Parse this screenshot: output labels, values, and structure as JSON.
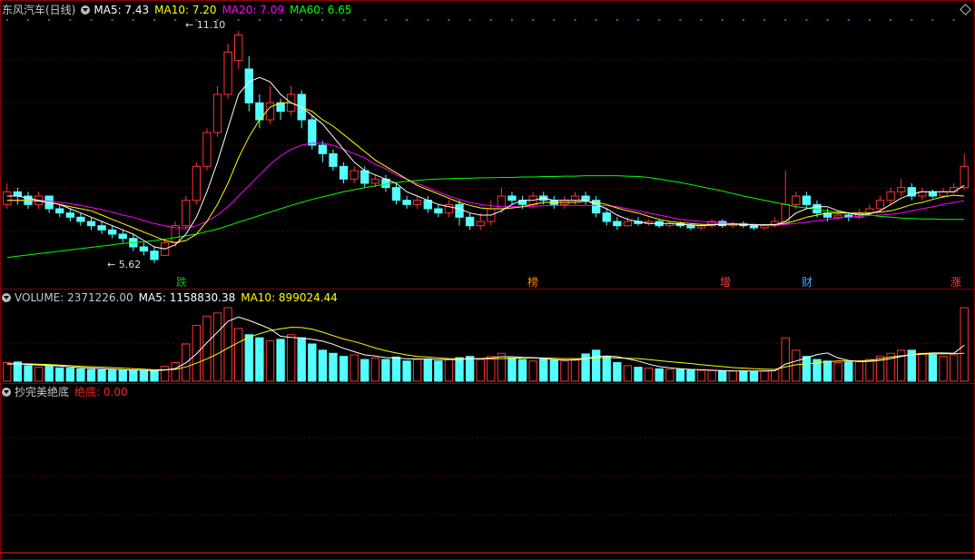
{
  "main": {
    "title": "东风汽车(日线)",
    "ma5_label": "MA5: 7.43",
    "ma10_label": "MA10: 7.20",
    "ma20_label": "MA20: 7.09",
    "ma60_label": "MA60: 6.65",
    "high_label": "11.10",
    "low_label": "5.62",
    "colors": {
      "ma5": "#ffffff",
      "ma10": "#ffff00",
      "ma20": "#ff00ff",
      "ma60": "#00ff00",
      "up": "#ff3232",
      "down": "#54ffff"
    }
  },
  "events": [
    {
      "label": "跌",
      "color": "#00c000"
    },
    {
      "label": "榜",
      "color": "#ff8c00"
    },
    {
      "label": "增",
      "color": "#ff4040"
    },
    {
      "label": "财",
      "color": "#4da6ff"
    },
    {
      "label": "涨",
      "color": "#ff4040"
    }
  ],
  "volume": {
    "title": "VOLUME: 2371226.00",
    "ma5_label": "MA5: 1158830.38",
    "ma10_label": "MA10: 899024.44"
  },
  "indicator": {
    "title": "抄完美绝底",
    "value_label": "绝底: 0.00"
  },
  "chart_data": {
    "type": "candlestick",
    "price_range": [
      5.4,
      11.4
    ],
    "candles": [
      [
        7.0,
        7.3,
        7.5,
        6.9
      ],
      [
        7.3,
        7.2,
        7.4,
        7.0
      ],
      [
        7.2,
        7.0,
        7.3,
        6.9
      ],
      [
        7.0,
        7.2,
        7.3,
        6.9
      ],
      [
        7.2,
        6.9,
        7.2,
        6.8
      ],
      [
        6.9,
        6.8,
        7.0,
        6.7
      ],
      [
        6.8,
        6.7,
        6.9,
        6.6
      ],
      [
        6.7,
        6.6,
        6.8,
        6.5
      ],
      [
        6.6,
        6.5,
        6.7,
        6.4
      ],
      [
        6.5,
        6.4,
        6.6,
        6.3
      ],
      [
        6.4,
        6.3,
        6.5,
        6.2
      ],
      [
        6.3,
        6.2,
        6.4,
        6.1
      ],
      [
        6.2,
        6.0,
        6.3,
        5.9
      ],
      [
        6.0,
        5.9,
        6.1,
        5.8
      ],
      [
        5.9,
        5.7,
        6.0,
        5.62
      ],
      [
        5.8,
        6.1,
        6.2,
        5.8
      ],
      [
        6.1,
        6.5,
        6.6,
        6.0
      ],
      [
        6.5,
        7.1,
        7.2,
        6.4
      ],
      [
        7.1,
        7.9,
        8.0,
        7.0
      ],
      [
        7.9,
        8.7,
        8.8,
        7.8
      ],
      [
        8.7,
        9.6,
        9.8,
        8.6
      ],
      [
        9.6,
        10.6,
        10.8,
        9.5
      ],
      [
        10.4,
        11.0,
        11.1,
        10.2
      ],
      [
        10.2,
        9.4,
        10.5,
        9.2
      ],
      [
        9.4,
        9.0,
        9.6,
        8.8
      ],
      [
        9.0,
        9.4,
        9.8,
        8.9
      ],
      [
        9.4,
        9.2,
        9.5,
        9.0
      ],
      [
        9.2,
        9.6,
        9.8,
        9.1
      ],
      [
        9.6,
        9.0,
        9.7,
        8.8
      ],
      [
        9.0,
        8.4,
        9.1,
        8.3
      ],
      [
        8.4,
        8.2,
        8.5,
        8.0
      ],
      [
        8.2,
        7.9,
        8.3,
        7.8
      ],
      [
        7.9,
        7.6,
        8.0,
        7.5
      ],
      [
        7.6,
        7.8,
        7.9,
        7.5
      ],
      [
        7.8,
        7.5,
        7.9,
        7.4
      ],
      [
        7.5,
        7.6,
        7.7,
        7.4
      ],
      [
        7.6,
        7.4,
        7.7,
        7.3
      ],
      [
        7.4,
        7.1,
        7.5,
        7.0
      ],
      [
        7.1,
        7.0,
        7.2,
        6.9
      ],
      [
        7.0,
        7.1,
        7.2,
        6.9
      ],
      [
        7.1,
        6.9,
        7.2,
        6.8
      ],
      [
        6.9,
        6.8,
        7.0,
        6.7
      ],
      [
        6.8,
        7.0,
        7.1,
        6.7
      ],
      [
        7.0,
        6.7,
        7.1,
        6.5
      ],
      [
        6.7,
        6.5,
        6.8,
        6.4
      ],
      [
        6.5,
        6.6,
        6.8,
        6.4
      ],
      [
        6.6,
        6.9,
        7.1,
        6.5
      ],
      [
        6.9,
        7.2,
        7.4,
        6.8
      ],
      [
        7.2,
        7.1,
        7.3,
        7.0
      ],
      [
        7.1,
        7.0,
        7.2,
        6.9
      ],
      [
        7.0,
        7.2,
        7.3,
        6.9
      ],
      [
        7.2,
        7.1,
        7.3,
        7.0
      ],
      [
        7.1,
        7.0,
        7.2,
        6.9
      ],
      [
        7.0,
        7.1,
        7.2,
        6.9
      ],
      [
        7.1,
        7.2,
        7.3,
        7.0
      ],
      [
        7.2,
        7.1,
        7.3,
        7.0
      ],
      [
        7.1,
        6.8,
        7.2,
        6.7
      ],
      [
        6.8,
        6.6,
        6.9,
        6.5
      ],
      [
        6.6,
        6.5,
        6.7,
        6.4
      ],
      [
        6.5,
        6.6,
        6.7,
        6.5
      ],
      [
        6.6,
        6.55,
        6.7,
        6.5
      ],
      [
        6.55,
        6.6,
        6.65,
        6.5
      ],
      [
        6.6,
        6.5,
        6.65,
        6.45
      ],
      [
        6.5,
        6.55,
        6.6,
        6.45
      ],
      [
        6.55,
        6.5,
        6.6,
        6.45
      ],
      [
        6.5,
        6.45,
        6.55,
        6.4
      ],
      [
        6.45,
        6.5,
        6.55,
        6.4
      ],
      [
        6.5,
        6.6,
        6.65,
        6.45
      ],
      [
        6.6,
        6.5,
        6.65,
        6.45
      ],
      [
        6.5,
        6.55,
        6.6,
        6.45
      ],
      [
        6.55,
        6.5,
        6.6,
        6.45
      ],
      [
        6.5,
        6.45,
        6.55,
        6.4
      ],
      [
        6.45,
        6.5,
        6.55,
        6.4
      ],
      [
        6.5,
        6.6,
        6.7,
        6.45
      ],
      [
        6.6,
        7.0,
        7.8,
        6.55
      ],
      [
        7.0,
        7.2,
        7.3,
        6.9
      ],
      [
        7.2,
        7.0,
        7.3,
        6.9
      ],
      [
        7.0,
        6.8,
        7.1,
        6.7
      ],
      [
        6.8,
        6.7,
        6.9,
        6.6
      ],
      [
        6.7,
        6.75,
        6.85,
        6.65
      ],
      [
        6.75,
        6.7,
        6.8,
        6.6
      ],
      [
        6.7,
        6.8,
        6.9,
        6.65
      ],
      [
        6.8,
        6.9,
        7.0,
        6.75
      ],
      [
        6.9,
        7.1,
        7.2,
        6.85
      ],
      [
        7.1,
        7.3,
        7.4,
        7.0
      ],
      [
        7.3,
        7.4,
        7.6,
        7.2
      ],
      [
        7.4,
        7.2,
        7.5,
        7.1
      ],
      [
        7.2,
        7.3,
        7.4,
        7.1
      ],
      [
        7.3,
        7.2,
        7.35,
        7.15
      ],
      [
        7.2,
        7.3,
        7.4,
        7.15
      ],
      [
        7.3,
        7.4,
        7.5,
        7.25
      ],
      [
        7.4,
        7.9,
        8.2,
        7.35
      ]
    ],
    "ma5": [
      7.2,
      7.2,
      7.15,
      7.1,
      7.05,
      7.0,
      6.9,
      6.8,
      6.7,
      6.6,
      6.5,
      6.4,
      6.3,
      6.15,
      6.0,
      5.95,
      6.05,
      6.3,
      6.7,
      7.3,
      8.0,
      8.8,
      9.6,
      9.9,
      10.0,
      9.9,
      9.6,
      9.4,
      9.3,
      9.1,
      8.9,
      8.6,
      8.3,
      8.0,
      7.8,
      7.7,
      7.6,
      7.5,
      7.3,
      7.2,
      7.1,
      7.0,
      6.95,
      6.9,
      6.8,
      6.75,
      6.75,
      6.85,
      7.0,
      7.1,
      7.1,
      7.15,
      7.1,
      7.1,
      7.1,
      7.1,
      7.0,
      6.9,
      6.75,
      6.65,
      6.6,
      6.55,
      6.55,
      6.55,
      6.53,
      6.52,
      6.5,
      6.52,
      6.53,
      6.54,
      6.53,
      6.52,
      6.52,
      6.52,
      6.6,
      6.8,
      6.9,
      6.95,
      6.95,
      6.85,
      6.8,
      6.75,
      6.78,
      6.85,
      7.0,
      7.15,
      7.25,
      7.3,
      7.3,
      7.3,
      7.3,
      7.45
    ],
    "ma10": [
      7.1,
      7.1,
      7.1,
      7.08,
      7.05,
      7.0,
      6.95,
      6.9,
      6.85,
      6.75,
      6.65,
      6.55,
      6.45,
      6.35,
      6.25,
      6.15,
      6.1,
      6.15,
      6.3,
      6.6,
      7.0,
      7.5,
      8.1,
      8.6,
      9.0,
      9.3,
      9.4,
      9.4,
      9.3,
      9.2,
      9.0,
      8.85,
      8.65,
      8.45,
      8.25,
      8.05,
      7.9,
      7.75,
      7.6,
      7.45,
      7.35,
      7.25,
      7.15,
      7.05,
      6.98,
      6.92,
      6.9,
      6.9,
      6.92,
      6.95,
      7.0,
      7.05,
      7.05,
      7.05,
      7.05,
      7.08,
      7.05,
      7.0,
      6.92,
      6.85,
      6.8,
      6.72,
      6.65,
      6.6,
      6.57,
      6.55,
      6.53,
      6.53,
      6.53,
      6.53,
      6.53,
      6.52,
      6.52,
      6.53,
      6.55,
      6.62,
      6.7,
      6.75,
      6.8,
      6.8,
      6.8,
      6.8,
      6.8,
      6.82,
      6.85,
      6.92,
      7.0,
      7.05,
      7.12,
      7.18,
      7.22,
      7.2
    ],
    "ma20": [
      7.1,
      7.1,
      7.1,
      7.1,
      7.08,
      7.05,
      7.02,
      6.98,
      6.93,
      6.88,
      6.82,
      6.75,
      6.7,
      6.62,
      6.55,
      6.5,
      6.45,
      6.45,
      6.5,
      6.6,
      6.75,
      6.95,
      7.2,
      7.45,
      7.7,
      7.95,
      8.15,
      8.3,
      8.4,
      8.45,
      8.45,
      8.4,
      8.3,
      8.2,
      8.1,
      7.95,
      7.85,
      7.7,
      7.6,
      7.5,
      7.4,
      7.3,
      7.2,
      7.12,
      7.05,
      7.0,
      6.97,
      6.95,
      6.95,
      6.95,
      6.96,
      6.97,
      6.98,
      6.98,
      6.98,
      6.98,
      6.98,
      6.97,
      6.95,
      6.9,
      6.85,
      6.8,
      6.75,
      6.7,
      6.65,
      6.62,
      6.6,
      6.58,
      6.56,
      6.55,
      6.54,
      6.53,
      6.52,
      6.52,
      6.53,
      6.55,
      6.58,
      6.62,
      6.65,
      6.68,
      6.7,
      6.72,
      6.74,
      6.75,
      6.77,
      6.8,
      6.85,
      6.9,
      6.95,
      7.0,
      7.05,
      7.09
    ],
    "ma60": [
      5.75,
      5.78,
      5.81,
      5.84,
      5.87,
      5.9,
      5.93,
      5.96,
      5.99,
      6.02,
      6.05,
      6.08,
      6.1,
      6.12,
      6.15,
      6.18,
      6.22,
      6.26,
      6.3,
      6.36,
      6.42,
      6.5,
      6.58,
      6.66,
      6.74,
      6.82,
      6.9,
      6.98,
      7.05,
      7.12,
      7.18,
      7.24,
      7.3,
      7.35,
      7.4,
      7.44,
      7.48,
      7.52,
      7.55,
      7.57,
      7.59,
      7.6,
      7.61,
      7.62,
      7.62,
      7.63,
      7.63,
      7.64,
      7.64,
      7.65,
      7.65,
      7.66,
      7.66,
      7.67,
      7.67,
      7.68,
      7.68,
      7.68,
      7.68,
      7.67,
      7.66,
      7.64,
      7.6,
      7.56,
      7.52,
      7.47,
      7.42,
      7.37,
      7.32,
      7.26,
      7.2,
      7.15,
      7.1,
      7.05,
      7.0,
      6.95,
      6.92,
      6.88,
      6.85,
      6.82,
      6.8,
      6.78,
      6.75,
      6.72,
      6.7,
      6.68,
      6.67,
      6.66,
      6.66,
      6.65,
      6.65,
      6.65
    ],
    "volume_range": [
      0,
      2400000
    ],
    "volumes": [
      600000,
      620000,
      500000,
      450000,
      480000,
      430000,
      420000,
      400000,
      380000,
      370000,
      360000,
      350000,
      340000,
      330000,
      320000,
      480000,
      600000,
      1200000,
      1800000,
      2100000,
      2200000,
      2371226,
      1700000,
      1500000,
      1400000,
      1300000,
      1350000,
      1500000,
      1400000,
      1200000,
      1000000,
      900000,
      800000,
      850000,
      700000,
      750000,
      700000,
      780000,
      650000,
      700000,
      720000,
      650000,
      700000,
      760000,
      800000,
      700000,
      800000,
      900000,
      750000,
      700000,
      650000,
      720000,
      680000,
      650000,
      700000,
      880000,
      1000000,
      800000,
      600000,
      500000,
      450000,
      420000,
      400000,
      380000,
      380000,
      360000,
      350000,
      340000,
      330000,
      320000,
      330000,
      320000,
      330000,
      380000,
      1400000,
      1000000,
      800000,
      700000,
      650000,
      600000,
      620000,
      650000,
      700000,
      800000,
      900000,
      1000000,
      1000000,
      900000,
      850000,
      800000,
      850000,
      2371226
    ],
    "volume_ma5": [
      550000,
      560000,
      540000,
      520000,
      510000,
      490000,
      460000,
      440000,
      420000,
      400000,
      385000,
      370000,
      360000,
      350000,
      340000,
      360000,
      410000,
      590000,
      880000,
      1240000,
      1580000,
      1930000,
      2070000,
      1960000,
      1830000,
      1690000,
      1450000,
      1410000,
      1390000,
      1350000,
      1290000,
      1190000,
      1060000,
      950000,
      850000,
      810000,
      760000,
      750000,
      720000,
      720000,
      710000,
      700000,
      700000,
      700000,
      730000,
      730000,
      750000,
      790000,
      790000,
      770000,
      760000,
      740000,
      700000,
      680000,
      680000,
      730000,
      790000,
      810000,
      790000,
      720000,
      650000,
      550000,
      470000,
      430000,
      400000,
      380000,
      370000,
      355000,
      345000,
      335000,
      330000,
      330000,
      328000,
      337000,
      552000,
      650000,
      750000,
      860000,
      910000,
      750000,
      670000,
      630000,
      640000,
      670000,
      730000,
      800000,
      860000,
      890000,
      910000,
      910000,
      900000,
      1158830
    ],
    "volume_ma10": [
      560000,
      565000,
      560000,
      550000,
      540000,
      520000,
      500000,
      480000,
      465000,
      455000,
      440000,
      420000,
      400000,
      385000,
      370000,
      370000,
      380000,
      460000,
      580000,
      720000,
      880000,
      1070000,
      1250000,
      1420000,
      1530000,
      1630000,
      1690000,
      1740000,
      1730000,
      1680000,
      1580000,
      1470000,
      1360000,
      1280000,
      1180000,
      1070000,
      980000,
      910000,
      850000,
      800000,
      780000,
      750000,
      730000,
      720000,
      720000,
      720000,
      720000,
      730000,
      740000,
      750000,
      750000,
      750000,
      740000,
      730000,
      730000,
      730000,
      750000,
      760000,
      750000,
      740000,
      730000,
      700000,
      660000,
      630000,
      600000,
      570000,
      530000,
      500000,
      470000,
      440000,
      420000,
      400000,
      390000,
      380000,
      460000,
      530000,
      560000,
      590000,
      630000,
      650000,
      650000,
      650000,
      670000,
      720000,
      780000,
      820000,
      850000,
      870000,
      880000,
      880000,
      890000,
      899024
    ],
    "signal_range": [
      0,
      1
    ],
    "signal": [
      0,
      0,
      0,
      0,
      0,
      0,
      0,
      0,
      0,
      0,
      0,
      0,
      0,
      0,
      0,
      0,
      0,
      0,
      0,
      0,
      0,
      0,
      0,
      0,
      0,
      0,
      0,
      0,
      0,
      0,
      0,
      0,
      0,
      0,
      0,
      0,
      0,
      0,
      0,
      0,
      0,
      0,
      0,
      0,
      0,
      0,
      0,
      0,
      0,
      0,
      0,
      0,
      0,
      0,
      0,
      0,
      0,
      0,
      0,
      0,
      0,
      0,
      0,
      0,
      0,
      0,
      0,
      0,
      0,
      0,
      0,
      0,
      0,
      0,
      0,
      0,
      0,
      0,
      0,
      0,
      0,
      0,
      0,
      0,
      0,
      0,
      0,
      0,
      0,
      0,
      0,
      0
    ]
  }
}
